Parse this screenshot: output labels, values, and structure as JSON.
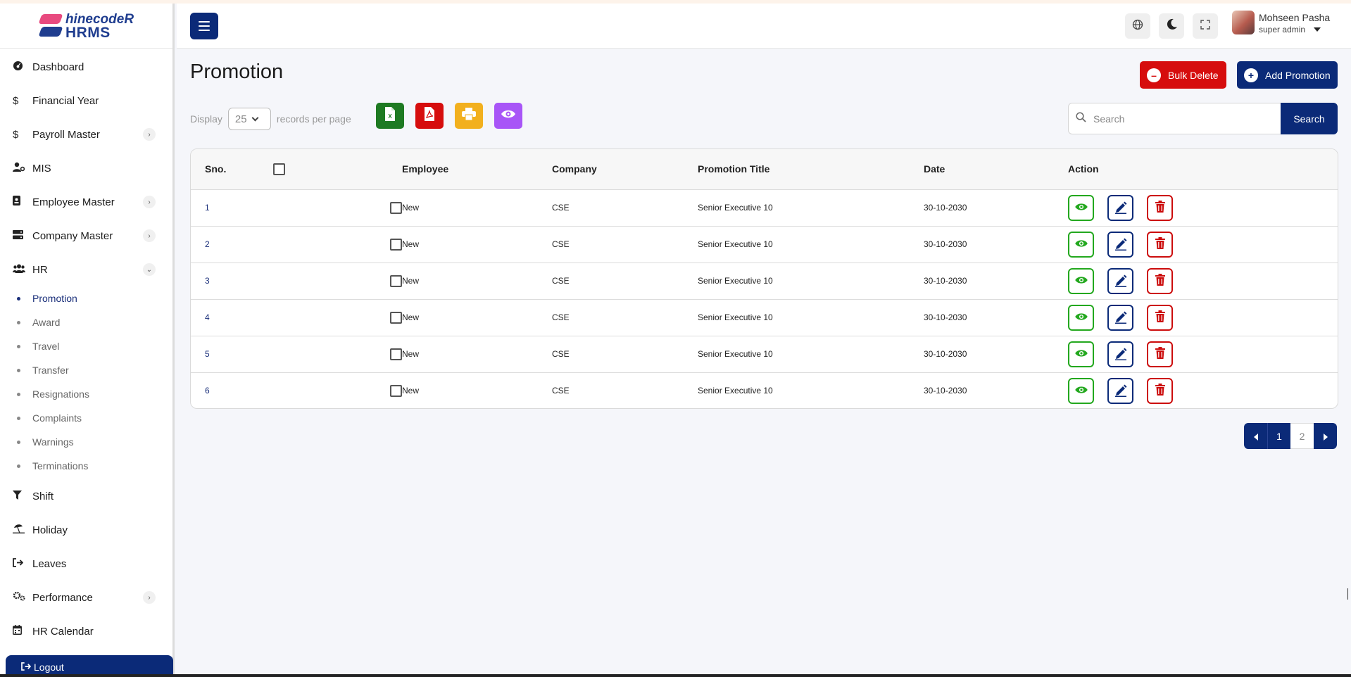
{
  "app": {
    "logo_top": "hinecodeR",
    "logo_bottom": "HRMS"
  },
  "sidebar": {
    "items": [
      {
        "label": "Dashboard",
        "icon": "dashboard-icon"
      },
      {
        "label": "Financial Year",
        "icon": "dollar-icon"
      },
      {
        "label": "Payroll Master",
        "icon": "dollar-icon",
        "has_children": true
      },
      {
        "label": "MIS",
        "icon": "user-gear-icon"
      },
      {
        "label": "Employee Master",
        "icon": "id-badge-icon",
        "has_children": true
      },
      {
        "label": "Company Master",
        "icon": "server-icon",
        "has_children": true
      },
      {
        "label": "HR",
        "icon": "users-icon",
        "expanded": true
      }
    ],
    "hr_subitems": [
      "Promotion",
      "Award",
      "Travel",
      "Transfer",
      "Resignations",
      "Complaints",
      "Warnings",
      "Terminations"
    ],
    "active_subitem": "Promotion",
    "items_after": [
      {
        "label": "Shift",
        "icon": "filter-icon"
      },
      {
        "label": "Holiday",
        "icon": "umbrella-beach-icon"
      },
      {
        "label": "Leaves",
        "icon": "sign-out-icon"
      },
      {
        "label": "Performance",
        "icon": "gears-icon",
        "has_children": true
      },
      {
        "label": "HR Calendar",
        "icon": "calendar-icon"
      }
    ],
    "logout_label": "Logout"
  },
  "header": {
    "user_name": "Mohseen Pasha",
    "user_role": "super admin"
  },
  "page": {
    "title": "Promotion",
    "bulk_delete_label": "Bulk Delete",
    "add_label": "Add Promotion",
    "display_label": "Display",
    "per_page_value": "25",
    "records_label": "records per page",
    "search_placeholder": "Search",
    "search_button": "Search"
  },
  "export_buttons": [
    {
      "name": "excel-export",
      "color": "#1e7a22"
    },
    {
      "name": "pdf-export",
      "color": "#d60d0d"
    },
    {
      "name": "print",
      "color": "#f2b01e"
    },
    {
      "name": "column-visibility",
      "color": "#a855f7"
    }
  ],
  "table": {
    "headers": {
      "sno": "Sno.",
      "employee": "Employee",
      "company": "Company",
      "promotion_title": "Promotion Title",
      "date": "Date",
      "action": "Action"
    },
    "rows": [
      {
        "sno": "1",
        "employee": "New",
        "company": "CSE",
        "promotion_title": "Senior Executive 10",
        "date": "30-10-2030"
      },
      {
        "sno": "2",
        "employee": "New",
        "company": "CSE",
        "promotion_title": "Senior Executive 10",
        "date": "30-10-2030"
      },
      {
        "sno": "3",
        "employee": "New",
        "company": "CSE",
        "promotion_title": "Senior Executive 10",
        "date": "30-10-2030"
      },
      {
        "sno": "4",
        "employee": "New",
        "company": "CSE",
        "promotion_title": "Senior Executive 10",
        "date": "30-10-2030"
      },
      {
        "sno": "5",
        "employee": "New",
        "company": "CSE",
        "promotion_title": "Senior Executive 10",
        "date": "30-10-2030"
      },
      {
        "sno": "6",
        "employee": "New",
        "company": "CSE",
        "promotion_title": "Senior Executive 10",
        "date": "30-10-2030"
      }
    ]
  },
  "pagination": {
    "pages": [
      "1",
      "2"
    ],
    "current": "1"
  },
  "colors": {
    "primary": "#0b2a78",
    "danger": "#d60d0d",
    "success": "#23a81e"
  }
}
